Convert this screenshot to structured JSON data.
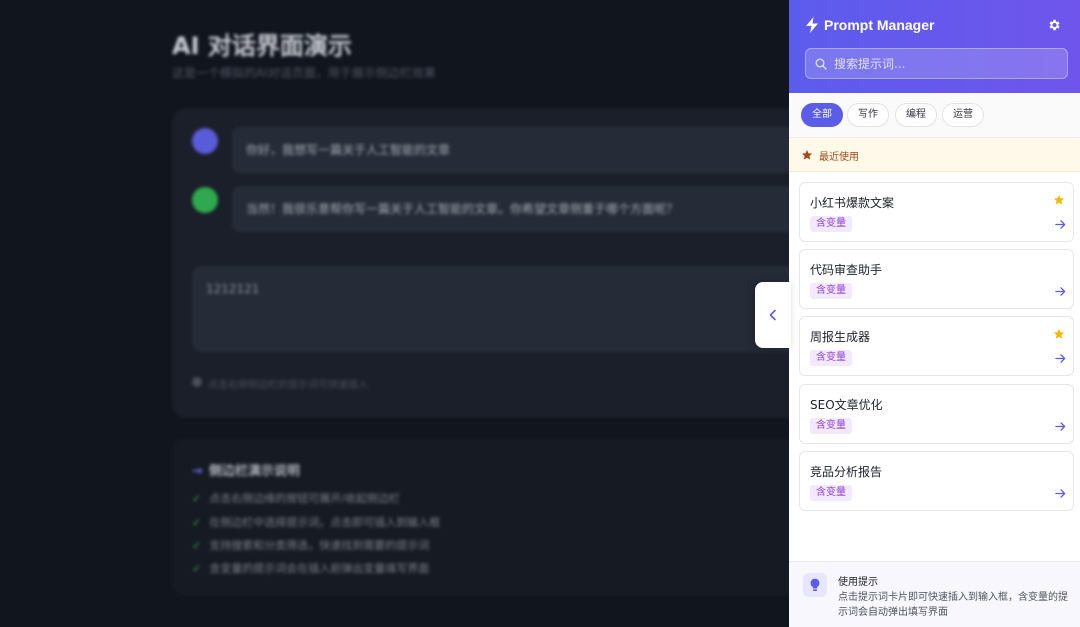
{
  "background": {
    "title": "AI 对话界面演示",
    "subtitle": "这是一个模拟的AI对话页面，用于展示侧边栏效果",
    "messages": [
      {
        "role": "user",
        "text": "你好，我想写一篇关于人工智能的文章"
      },
      {
        "role": "ai",
        "text": "当然！我很乐意帮你写一篇关于人工智能的文章。你希望文章侧重于哪个方面呢？"
      }
    ],
    "input_value": "1212121",
    "input_hint": "点击右侧侧边栏的提示词可快速插入",
    "guide": {
      "title": "侧边栏演示说明",
      "items": [
        "点击右侧边缘的按钮可展开/收起侧边栏",
        "在侧边栏中选择提示词，点击即可插入到输入框",
        "支持搜索和分类筛选，快速找到需要的提示词",
        "含变量的提示词会在插入前弹出变量填写界面"
      ]
    }
  },
  "sidebar": {
    "title": "Prompt Manager",
    "search_placeholder": "搜索提示词...",
    "tabs": [
      {
        "label": "全部",
        "active": true
      },
      {
        "label": "写作",
        "active": false
      },
      {
        "label": "编程",
        "active": false
      },
      {
        "label": "运营",
        "active": false
      }
    ],
    "recent_label": "最近使用",
    "prompts": [
      {
        "name": "小红书爆款文案",
        "tag": "含变量",
        "favorite": true
      },
      {
        "name": "代码审查助手",
        "tag": "含变量",
        "favorite": false
      },
      {
        "name": "周报生成器",
        "tag": "含变量",
        "favorite": true
      },
      {
        "name": "SEO文章优化",
        "tag": "含变量",
        "favorite": false
      },
      {
        "name": "竞品分析报告",
        "tag": "含变量",
        "favorite": false
      }
    ],
    "tips": {
      "title": "使用提示",
      "body": "点击提示词卡片即可快速插入到输入框，含变量的提示词会自动弹出填写界面"
    }
  },
  "colors": {
    "accent": "#5b5ce8",
    "header_gradient_start": "#5c5cec",
    "header_gradient_end": "#6f55ec",
    "favorite_star": "#f5b800",
    "tag_text": "#8c3fd4",
    "tag_bg": "#f3e9fc",
    "recent_bg": "#fff9e9",
    "recent_text": "#a8491a"
  },
  "icons": {
    "logo": "lightning-icon",
    "settings": "gear-icon",
    "search": "search-icon",
    "recent": "star-icon",
    "favorite": "star-icon",
    "insert": "arrow-right-icon",
    "toggle": "chevron-left-icon",
    "tips": "lightbulb-icon"
  }
}
